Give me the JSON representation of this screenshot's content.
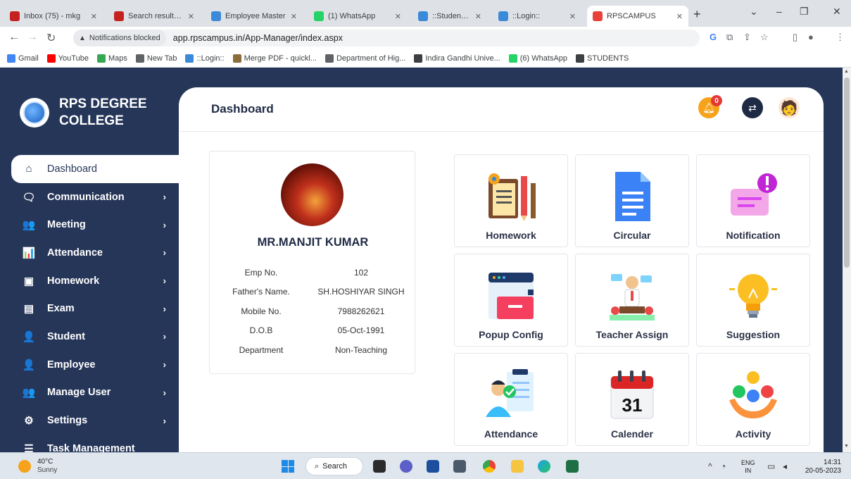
{
  "browser": {
    "tabs": [
      {
        "label": "Inbox (75) - mkg",
        "icon": "gmail-icon",
        "color": "#c5221f"
      },
      {
        "label": "Search results - e",
        "icon": "gmail-icon",
        "color": "#c5221f"
      },
      {
        "label": "Employee Master",
        "icon": "site-icon",
        "color": "#3b8ad9"
      },
      {
        "label": "(1) WhatsApp",
        "icon": "whatsapp-icon",
        "color": "#25d366"
      },
      {
        "label": "::Student Details::",
        "icon": "site-icon",
        "color": "#3b8ad9"
      },
      {
        "label": "::Login::",
        "icon": "site-icon",
        "color": "#3b8ad9"
      },
      {
        "label": "RPSCAMPUS",
        "icon": "rpscampus-icon",
        "color": "#e8423a",
        "active": true
      }
    ],
    "notification_chip": "Notifications blocked",
    "url": "app.rpscampus.in/App-Manager/index.aspx",
    "bookmarks": [
      {
        "label": "Gmail",
        "icon": "google-icon",
        "color": "#4285f4"
      },
      {
        "label": "YouTube",
        "icon": "youtube-icon",
        "color": "#ff0000"
      },
      {
        "label": "Maps",
        "icon": "maps-icon",
        "color": "#34a853"
      },
      {
        "label": "New Tab",
        "icon": "globe-icon",
        "color": "#5f6368"
      },
      {
        "label": "::Login::",
        "icon": "site-icon",
        "color": "#3b8ad9"
      },
      {
        "label": "Merge PDF - quickl...",
        "icon": "pdf-icon",
        "color": "#8a6d3b"
      },
      {
        "label": "Department of Hig...",
        "icon": "globe-icon",
        "color": "#5f6368"
      },
      {
        "label": "Indira Gandhi Unive...",
        "icon": "graduation-icon",
        "color": "#3c4043"
      },
      {
        "label": "(6) WhatsApp",
        "icon": "whatsapp-icon",
        "color": "#25d366"
      },
      {
        "label": "STUDENTS",
        "icon": "graduation-icon",
        "color": "#3c4043"
      }
    ]
  },
  "sidebar": {
    "brand": "RPS DEGREE COLLEGE",
    "items": [
      {
        "label": "Dashboard",
        "icon": "home-icon",
        "glyph": "⌂",
        "active": true,
        "chevron": ""
      },
      {
        "label": "Communication",
        "icon": "chat-icon",
        "glyph": "🗨",
        "chevron": "›"
      },
      {
        "label": "Meeting",
        "icon": "people-icon",
        "glyph": "👥",
        "chevron": "›"
      },
      {
        "label": "Attendance",
        "icon": "bar-chart-icon",
        "glyph": "📊",
        "chevron": "›"
      },
      {
        "label": "Homework",
        "icon": "notebook-icon",
        "glyph": "▣",
        "chevron": "›"
      },
      {
        "label": "Exam",
        "icon": "exam-icon",
        "glyph": "▤",
        "chevron": "›"
      },
      {
        "label": "Student",
        "icon": "user-icon",
        "glyph": "👤",
        "chevron": "›"
      },
      {
        "label": "Employee",
        "icon": "user-icon",
        "glyph": "👤",
        "chevron": "›"
      },
      {
        "label": "Manage User",
        "icon": "people-icon",
        "glyph": "👥",
        "chevron": "›"
      },
      {
        "label": "Settings",
        "icon": "settings-icon",
        "glyph": "⚙",
        "chevron": "›"
      },
      {
        "label": "Task Management",
        "icon": "task-list-icon",
        "glyph": "☰",
        "chevron": ""
      }
    ]
  },
  "header": {
    "title": "Dashboard",
    "notification_count": "0"
  },
  "profile": {
    "name": "MR.MANJIT KUMAR",
    "fields": [
      {
        "label": "Emp No.",
        "value": "102"
      },
      {
        "label": "Father's Name.",
        "value": "SH.HOSHIYAR SINGH"
      },
      {
        "label": "Mobile No.",
        "value": "7988262621"
      },
      {
        "label": "D.O.B",
        "value": "05-Oct-1991"
      },
      {
        "label": "Department",
        "value": "Non-Teaching"
      }
    ]
  },
  "tiles": [
    {
      "label": "Homework",
      "icon": "homework-icon"
    },
    {
      "label": "Circular",
      "icon": "document-icon"
    },
    {
      "label": "Notification",
      "icon": "notification-icon"
    },
    {
      "label": "Popup Config",
      "icon": "popup-window-icon"
    },
    {
      "label": "Teacher Assign",
      "icon": "teacher-icon"
    },
    {
      "label": "Suggestion",
      "icon": "lightbulb-icon"
    },
    {
      "label": "Attendance",
      "icon": "attendance-icon"
    },
    {
      "label": "Calender",
      "icon": "calendar-icon",
      "day": "31"
    },
    {
      "label": "Activity",
      "icon": "activity-icon"
    }
  ],
  "taskbar": {
    "temperature": "40°C",
    "weather": "Sunny",
    "search": "Search",
    "lang_top": "ENG",
    "lang_bottom": "IN",
    "time": "14:31",
    "date": "20-05-2023"
  }
}
